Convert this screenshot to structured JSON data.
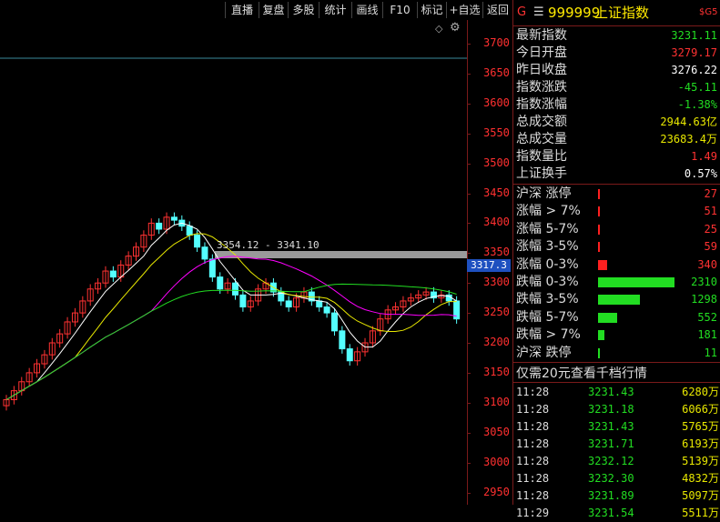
{
  "toolbar": {
    "buttons": [
      "直播",
      "复盘",
      "多股",
      "统计",
      "画线",
      "F10",
      "标记",
      "+自选",
      "返回"
    ]
  },
  "chart": {
    "range_label": "3354.12 - 3341.10",
    "price_tag": "3317.3",
    "y_ticks": [
      "3700",
      "3650",
      "3600",
      "3550",
      "3500",
      "3450",
      "3400",
      "3350",
      "3300",
      "3250",
      "3200",
      "3150",
      "3100",
      "3050",
      "3000",
      "2950"
    ]
  },
  "header": {
    "g": "G",
    "menu_icon": "menu-icon",
    "code": "999999",
    "name": "上证指数",
    "tag": "$G5"
  },
  "stats": [
    {
      "label": "最新指数",
      "value": "3231.11",
      "color": "green"
    },
    {
      "label": "今日开盘",
      "value": "3279.17",
      "color": "red"
    },
    {
      "label": "昨日收盘",
      "value": "3276.22",
      "color": "white"
    },
    {
      "label": "指数涨跌",
      "value": "-45.11",
      "color": "green"
    },
    {
      "label": "指数涨幅",
      "value": "-1.38%",
      "color": "green"
    },
    {
      "label": "总成交额",
      "value": "2944.63亿",
      "color": "yellow"
    },
    {
      "label": "总成交量",
      "value": "23683.4万",
      "color": "yellow"
    },
    {
      "label": "指数量比",
      "value": "1.49",
      "color": "red"
    },
    {
      "label": "上证换手",
      "value": "0.57%",
      "color": "white"
    }
  ],
  "breadth": [
    {
      "label": "沪深 涨停",
      "value": "27",
      "color": "red",
      "fraction": 0.005
    },
    {
      "label": "涨幅 > 7%",
      "value": "51",
      "color": "red",
      "fraction": 0.006
    },
    {
      "label": "涨幅 5-7%",
      "value": "25",
      "color": "red",
      "fraction": 0.005
    },
    {
      "label": "涨幅 3-5%",
      "value": "59",
      "color": "red",
      "fraction": 0.02
    },
    {
      "label": "涨幅 0-3%",
      "value": "340",
      "color": "red",
      "fraction": 0.12
    },
    {
      "label": "跌幅 0-3%",
      "value": "2310",
      "color": "green",
      "fraction": 1.0
    },
    {
      "label": "跌幅 3-5%",
      "value": "1298",
      "color": "green",
      "fraction": 0.55
    },
    {
      "label": "跌幅 5-7%",
      "value": "552",
      "color": "green",
      "fraction": 0.25
    },
    {
      "label": "跌幅 > 7%",
      "value": "181",
      "color": "green",
      "fraction": 0.08
    },
    {
      "label": "沪深 跌停",
      "value": "11",
      "color": "green",
      "fraction": 0.005
    }
  ],
  "ticks_title": "仅需20元查看千档行情",
  "ticks": [
    {
      "time": "11:28",
      "price": "3231.43",
      "vol": "6280万"
    },
    {
      "time": "11:28",
      "price": "3231.18",
      "vol": "6066万"
    },
    {
      "time": "11:28",
      "price": "3231.43",
      "vol": "5765万"
    },
    {
      "time": "11:28",
      "price": "3231.71",
      "vol": "6193万"
    },
    {
      "time": "11:28",
      "price": "3232.12",
      "vol": "5139万"
    },
    {
      "time": "11:28",
      "price": "3232.30",
      "vol": "4832万"
    },
    {
      "time": "11:28",
      "price": "3231.89",
      "vol": "5097万"
    },
    {
      "time": "11:29",
      "price": "3231.54",
      "vol": "5511万"
    }
  ],
  "colors": {
    "up": "#ff3232",
    "down": "#54ffff",
    "ma5": "#ffffff",
    "ma10": "#e8e800",
    "ma20": "#ff00ff",
    "ma60": "#22dd22"
  }
}
